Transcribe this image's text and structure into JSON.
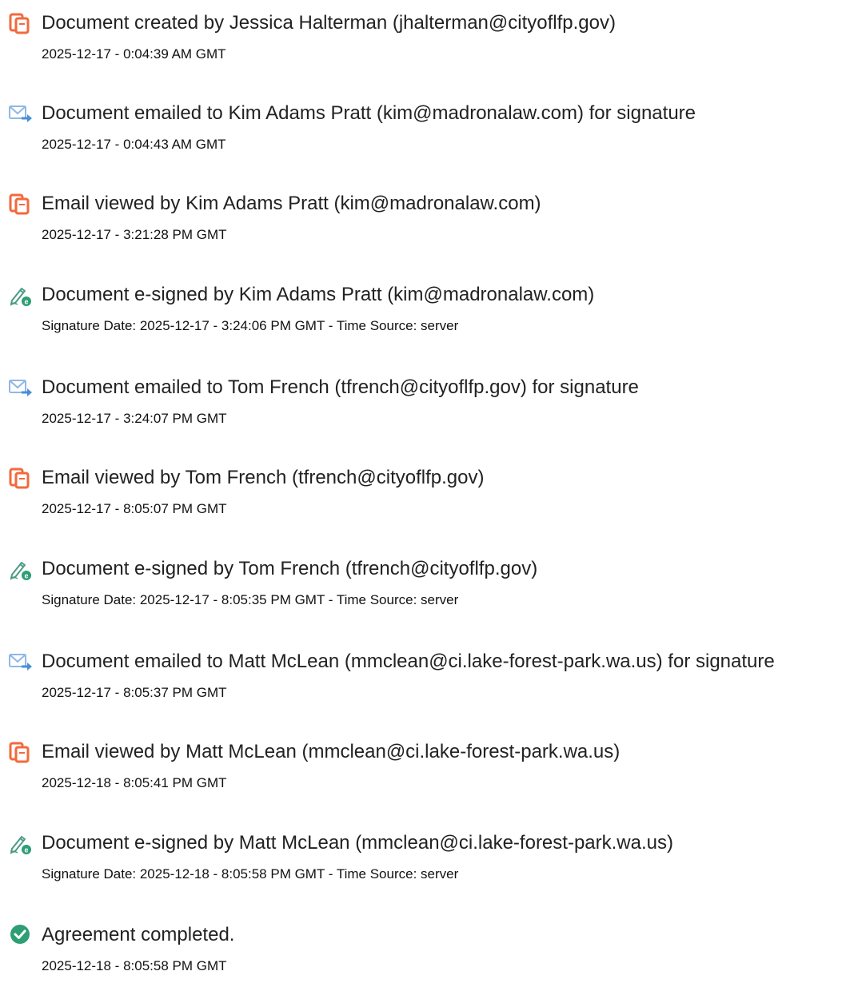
{
  "events": [
    {
      "icon": "document-created-icon",
      "title": "Document created by Jessica Halterman (jhalterman@cityoflfp.gov)",
      "detail": "2025-12-17 - 0:04:39 AM GMT"
    },
    {
      "icon": "email-sent-icon",
      "title": "Document emailed to Kim Adams Pratt (kim@madronalaw.com) for signature",
      "detail": "2025-12-17 - 0:04:43 AM GMT"
    },
    {
      "icon": "email-viewed-icon",
      "title": "Email viewed by Kim Adams Pratt (kim@madronalaw.com)",
      "detail": "2025-12-17 - 3:21:28 PM GMT"
    },
    {
      "icon": "esign-pen-icon",
      "title": "Document e-signed by Kim Adams Pratt (kim@madronalaw.com)",
      "detail": "Signature Date: 2025-12-17 - 3:24:06 PM GMT - Time Source: server"
    },
    {
      "icon": "email-sent-icon",
      "title": "Document emailed to Tom French (tfrench@cityoflfp.gov) for signature",
      "detail": "2025-12-17 - 3:24:07 PM GMT"
    },
    {
      "icon": "email-viewed-icon",
      "title": "Email viewed by Tom French (tfrench@cityoflfp.gov)",
      "detail": "2025-12-17 - 8:05:07 PM GMT"
    },
    {
      "icon": "esign-pen-icon",
      "title": "Document e-signed by Tom French (tfrench@cityoflfp.gov)",
      "detail": "Signature Date: 2025-12-17 - 8:05:35 PM GMT - Time Source: server"
    },
    {
      "icon": "email-sent-icon",
      "title": "Document emailed to Matt McLean (mmclean@ci.lake-forest-park.wa.us) for signature",
      "detail": "2025-12-17 - 8:05:37 PM GMT"
    },
    {
      "icon": "email-viewed-icon",
      "title": "Email viewed by Matt McLean (mmclean@ci.lake-forest-park.wa.us)",
      "detail": "2025-12-18 - 8:05:41 PM GMT"
    },
    {
      "icon": "esign-pen-icon",
      "title": "Document e-signed by Matt McLean (mmclean@ci.lake-forest-park.wa.us)",
      "detail": "Signature Date: 2025-12-18 - 8:05:58 PM GMT - Time Source: server"
    },
    {
      "icon": "agreement-completed-check-icon",
      "title": "Agreement completed.",
      "detail": "2025-12-18 - 8:05:58 PM GMT"
    }
  ],
  "colors": {
    "doc_icon": "#f26a3d",
    "email_icon_blue": "#4a8fd6",
    "pen_icon": "#4c9a86",
    "check_green": "#2e9e74",
    "title_text": "#222222",
    "detail_text": "#111111"
  }
}
